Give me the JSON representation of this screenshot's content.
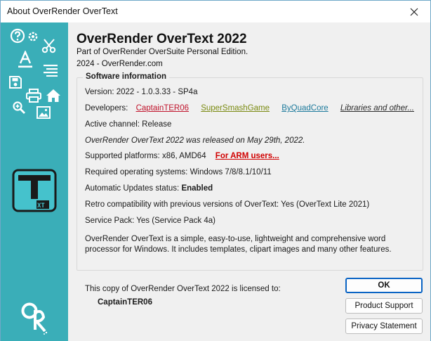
{
  "window": {
    "title": "About OverRender OverText",
    "close_glyph": "✕"
  },
  "sidebar": {
    "background": "#3aaeb8",
    "icons": [
      "help-icon",
      "settings-icon",
      "cut-icon",
      "font-icon",
      "align-icon",
      "save-icon",
      "print-icon",
      "home-icon",
      "zoom-icon",
      "image-icon"
    ],
    "app_logo": {
      "main_letter": "T",
      "sub_text": "XT"
    },
    "brand_logo": "OR"
  },
  "header": {
    "app_title": "OverRender OverText 2022",
    "edition": "Part of OverRender OverSuite Personal Edition.",
    "copyright": "2024 - OverRender.com"
  },
  "software_info": {
    "legend": "Software information",
    "version": "Version: 2022 - 1.0.3.33 - SP4a",
    "developers_label": "Developers:",
    "developers": [
      "CaptainTER06",
      "SuperSmashGame",
      "ByQuadCore",
      "Libraries and other..."
    ],
    "channel": "Active channel: Release",
    "release_note": "OverRender OverText 2022 was released on May 29th, 2022.",
    "platforms": "Supported platforms: x86, AMD64",
    "arm_link": "For ARM users...",
    "os": "Required operating systems: Windows 7/8/8.1/10/11",
    "updates_label": "Automatic Updates status:",
    "updates_value": "Enabled",
    "retro": "Retro compatibility with previous versions of OverText: Yes (OverText Lite 2021)",
    "service_pack": "Service Pack: Yes (Service Pack 4a)",
    "description": "OverRender OverText is a simple, easy-to-use, lightweight and comprehensive word processor for Windows. It includes templates, clipart images and many other features."
  },
  "license": {
    "text": "This copy of OverRender OverText 2022 is licensed to:",
    "name": "CaptainTER06"
  },
  "buttons": {
    "ok": "OK",
    "support": "Product Support",
    "privacy": "Privacy Statement"
  }
}
